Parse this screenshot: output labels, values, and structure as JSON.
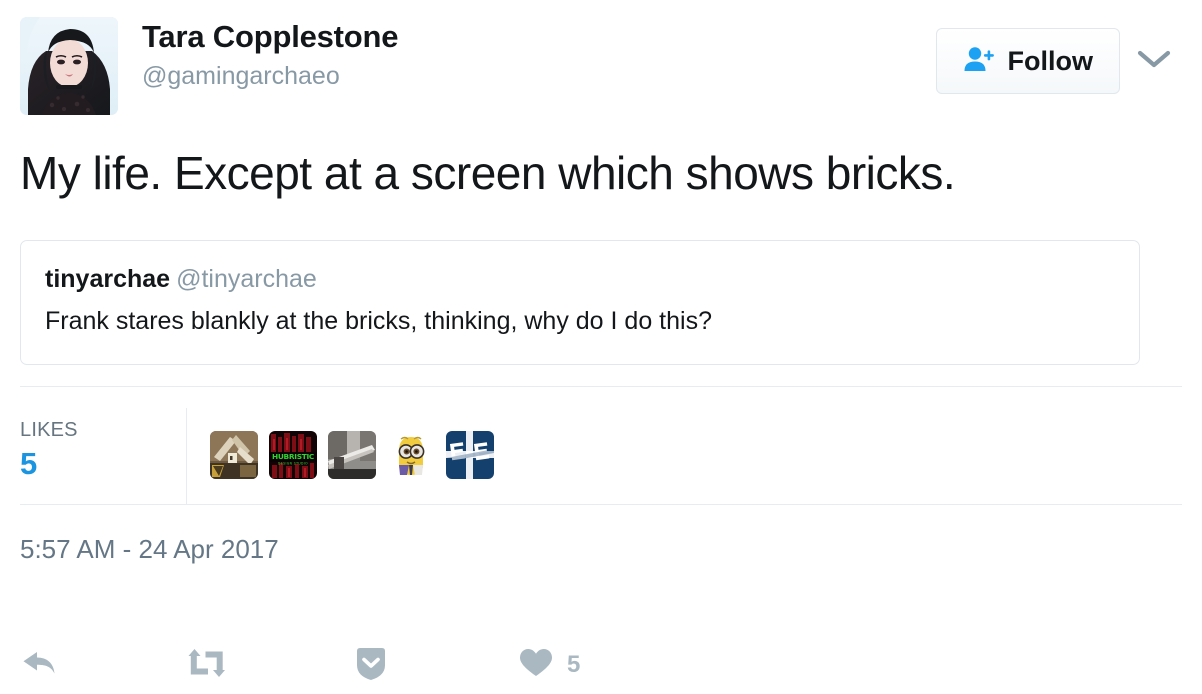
{
  "header": {
    "avatar_name": "tara-copplestone-avatar",
    "fullname": "Tara Copplestone",
    "handle": "@gamingarchaeo",
    "follow_label": "Follow",
    "follow_icon": "person-plus-icon",
    "caret_icon": "chevron-down-icon"
  },
  "tweet": {
    "text": "My life. Except at a screen which shows bricks.",
    "timestamp": "5:57 AM - 24 Apr 2017"
  },
  "quoted": {
    "name": "tinyarchae",
    "handle": "@tinyarchae",
    "text": "Frank stares blankly at the bricks, thinking, why do I do this?"
  },
  "likes": {
    "label": "LIKES",
    "count": "5",
    "likers": [
      {
        "name": "liker-avatar-1",
        "alt": "sepia excavation photo"
      },
      {
        "name": "liker-avatar-2",
        "alt": "dark red HUBRISTIC logo"
      },
      {
        "name": "liker-avatar-3",
        "alt": "grayscale interior photo"
      },
      {
        "name": "liker-avatar-4",
        "alt": "yellow minion cartoon"
      },
      {
        "name": "liker-avatar-5",
        "alt": "navy blue E E monogram"
      }
    ]
  },
  "actions": [
    {
      "name": "reply-button",
      "icon": "reply-icon",
      "count": ""
    },
    {
      "name": "retweet-button",
      "icon": "retweet-icon",
      "count": ""
    },
    {
      "name": "more-button",
      "icon": "shield-chevron-down-icon",
      "count": ""
    },
    {
      "name": "like-button",
      "icon": "heart-icon",
      "count": "5"
    }
  ],
  "colors": {
    "twitter_blue": "#1da1f2",
    "like_count_blue": "#1b95e0",
    "icon_gray": "#aab8c2",
    "muted_text": "#657786",
    "border": "#e1e8ed",
    "rule": "#e6ecf0"
  }
}
